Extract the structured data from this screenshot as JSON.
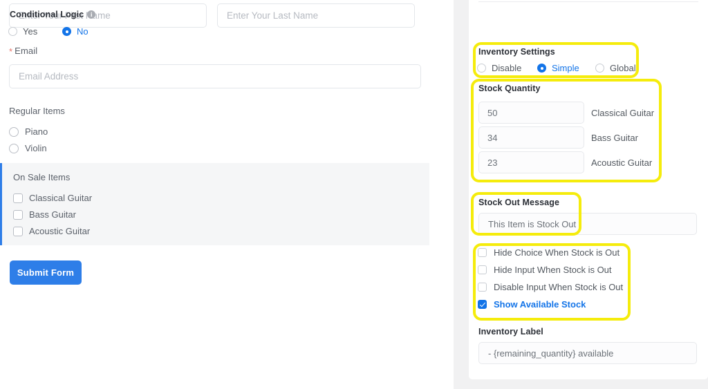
{
  "form": {
    "first_name": {
      "placeholder": "Enter Your First Name",
      "value": ""
    },
    "last_name": {
      "placeholder": "Enter Your Last Name",
      "value": ""
    },
    "email": {
      "label": "Email",
      "required_marker": "*",
      "placeholder": "Email Address",
      "value": ""
    },
    "regular_items": {
      "label": "Regular Items",
      "options": [
        {
          "label": "Piano",
          "selected": false
        },
        {
          "label": "Violin",
          "selected": false
        }
      ]
    },
    "on_sale_items": {
      "label": "On Sale Items",
      "options": [
        {
          "label": "Classical Guitar",
          "checked": false
        },
        {
          "label": "Bass Guitar",
          "checked": false
        },
        {
          "label": "Acoustic Guitar",
          "checked": false
        }
      ]
    },
    "submit_label": "Submit Form"
  },
  "settings": {
    "conditional_logic": {
      "title": "Conditional Logic",
      "info_icon": "info-icon",
      "info_glyph": "i",
      "options": [
        {
          "label": "Yes",
          "selected": false
        },
        {
          "label": "No",
          "selected": true
        }
      ]
    },
    "inventory_settings": {
      "title": "Inventory Settings",
      "options": [
        {
          "label": "Disable",
          "selected": false
        },
        {
          "label": "Simple",
          "selected": true
        },
        {
          "label": "Global",
          "selected": false
        }
      ]
    },
    "stock_quantity": {
      "title": "Stock Quantity",
      "rows": [
        {
          "value": "50",
          "name": "Classical Guitar"
        },
        {
          "value": "34",
          "name": "Bass Guitar"
        },
        {
          "value": "23",
          "name": "Acoustic Guitar"
        }
      ]
    },
    "stock_out_message": {
      "title": "Stock Out Message",
      "value": "This Item is Stock Out"
    },
    "toggles": [
      {
        "label": "Hide Choice When Stock is Out",
        "checked": false
      },
      {
        "label": "Hide Input When Stock is Out",
        "checked": false
      },
      {
        "label": "Disable Input When Stock is Out",
        "checked": false
      },
      {
        "label": "Show Available Stock",
        "checked": true
      }
    ],
    "inventory_label": {
      "title": "Inventory Label",
      "value": "- {remaining_quantity} available"
    }
  },
  "highlights": {
    "color": "#f5ec0c",
    "boxes": [
      "inventory-settings",
      "stock-quantity",
      "stock-out-message",
      "stock-toggles"
    ]
  },
  "colors": {
    "accent_blue": "#1374e8",
    "submit_blue": "#2e7ee8",
    "panel_bg": "#f1f1f2",
    "onsale_bg": "#f5f6f7",
    "required_red": "#e8766c"
  }
}
